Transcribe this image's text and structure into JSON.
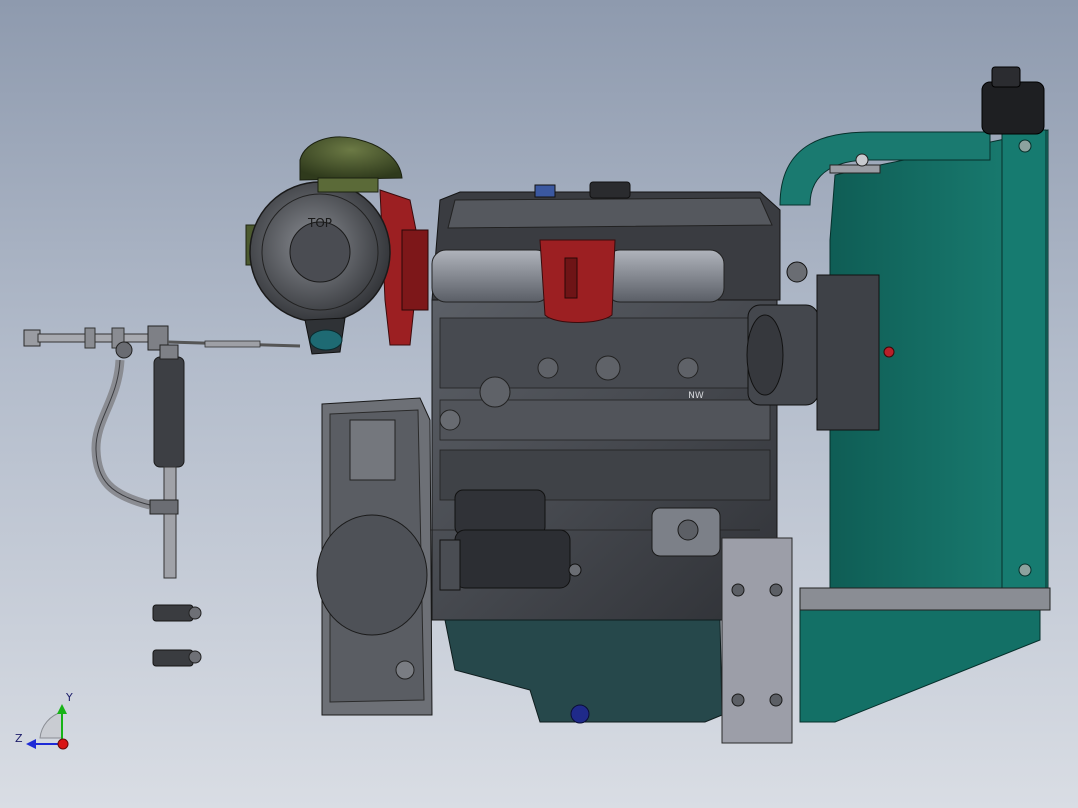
{
  "viewport": {
    "background_top": "#8e9aae",
    "background_bottom": "#d9dde4"
  },
  "model_labels": {
    "air_filter_label": "TOP",
    "block_casting_mark": "NW"
  },
  "triad": {
    "y_label": "Y",
    "z_label": "Z",
    "y_color": "#17b317",
    "z_color": "#1e2ad6",
    "x_color": "#d91414"
  },
  "colors": {
    "radiator": "#137066",
    "air_cleaner_cap": "#4c5a2f",
    "bracket_red": "#9c1f22",
    "engine_dark": "#3c3e43",
    "engine_light": "#7c8088",
    "metal": "#8d9097"
  }
}
